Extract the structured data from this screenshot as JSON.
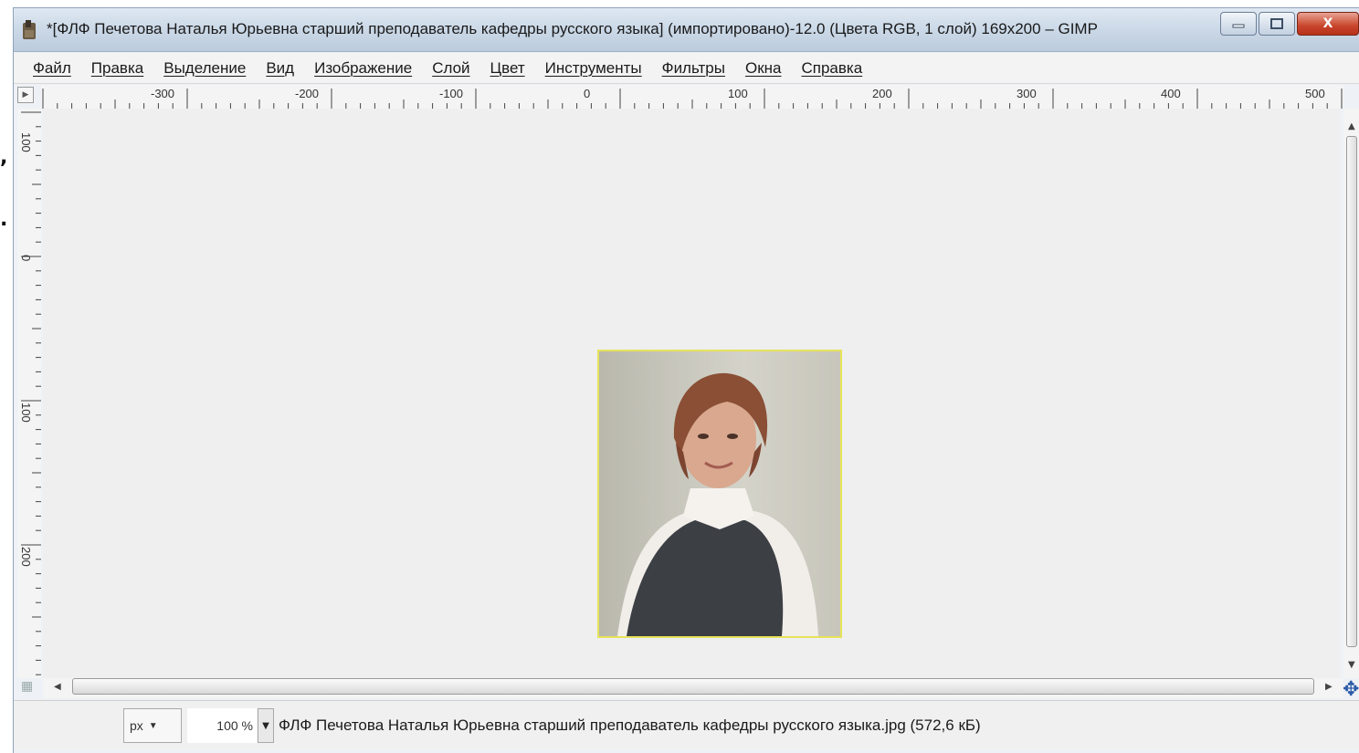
{
  "window": {
    "title": "*[ФЛФ Печетова Наталья Юрьевна старший преподаватель кафедры русского языка] (импортировано)-12.0 (Цвета RGB, 1 слой) 169x200 – GIMP",
    "close_label": "X"
  },
  "menu": {
    "items": [
      "Файл",
      "Правка",
      "Выделение",
      "Вид",
      "Изображение",
      "Слой",
      "Цвет",
      "Инструменты",
      "Фильтры",
      "Окна",
      "Справка"
    ]
  },
  "rulers": {
    "horizontal_labels": [
      "-300",
      "-200",
      "-100",
      "0",
      "100",
      "200",
      "300",
      "400",
      "500"
    ],
    "vertical_labels": [
      "100",
      "0",
      "100",
      "200"
    ]
  },
  "side_marks": [
    ",",
    "."
  ],
  "statusbar": {
    "unit": "px",
    "zoom": "100 %",
    "file_info": "ФЛФ Печетова Наталья Юрьевна старший преподаватель кафедры русского языка.jpg (572,6 кБ)"
  },
  "icons": {
    "app": "gimp-icon",
    "navigate": "navigate-icon",
    "quick_mask": "quick-mask-icon"
  },
  "colors": {
    "canvas_bg": "#efefef",
    "selection_marching_ants": "#e6e35a",
    "titlebar": "#c9d7e6",
    "close_button": "#c8452b"
  }
}
